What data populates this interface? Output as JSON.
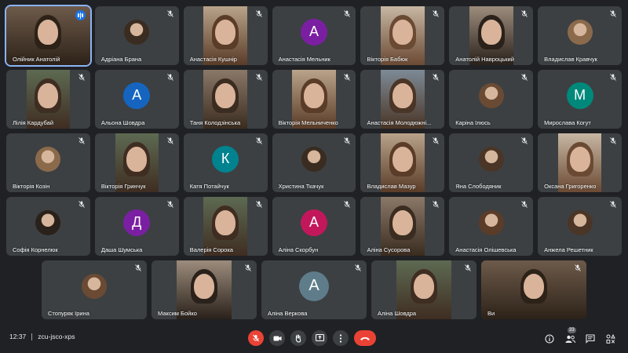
{
  "colors": {
    "accent": "#8ab4f8",
    "danger": "#ea4335",
    "tile": "#3c4043",
    "background": "#202124"
  },
  "participants": [
    {
      "name": "Олійник Анатолій",
      "kind": "video",
      "speaking": true,
      "self": true
    },
    {
      "name": "Адріана Брана",
      "kind": "thumb"
    },
    {
      "name": "Анастасія Кушнір",
      "kind": "video"
    },
    {
      "name": "Анастасія Мельник",
      "kind": "letter",
      "initial": "А",
      "color": "#7b1fa2"
    },
    {
      "name": "Вікторія Бабюк",
      "kind": "video"
    },
    {
      "name": "Анатолій Навроцький",
      "kind": "video"
    },
    {
      "name": "Владислав Кравчук",
      "kind": "thumb"
    },
    {
      "name": "Лілія Кардубай",
      "kind": "video"
    },
    {
      "name": "Альона Шовдра",
      "kind": "letter",
      "initial": "А",
      "color": "#1565c0"
    },
    {
      "name": "Таня Колодзінська",
      "kind": "video"
    },
    {
      "name": "Вікторія Мельниченко",
      "kind": "video"
    },
    {
      "name": "Анастасія Молодюжні...",
      "kind": "video"
    },
    {
      "name": "Каріна Ілюсь",
      "kind": "thumb"
    },
    {
      "name": "Мирослава Когут",
      "kind": "letter",
      "initial": "М",
      "color": "#00897b"
    },
    {
      "name": "Вікторія Козін",
      "kind": "thumb"
    },
    {
      "name": "Вікторія Гринчук",
      "kind": "video"
    },
    {
      "name": "Катя Потайчук",
      "kind": "letter",
      "initial": "К",
      "color": "#00838f"
    },
    {
      "name": "Христина Ткачук",
      "kind": "thumb"
    },
    {
      "name": "Владислав Мазур",
      "kind": "video"
    },
    {
      "name": "Яна Слободяник",
      "kind": "thumb"
    },
    {
      "name": "Оксана Григоренко",
      "kind": "video"
    },
    {
      "name": "Софія Корнелюк",
      "kind": "thumb"
    },
    {
      "name": "Даша Шумська",
      "kind": "letter",
      "initial": "Д",
      "color": "#7b1fa2"
    },
    {
      "name": "Валерія Сорока",
      "kind": "video"
    },
    {
      "name": "Аліна Скорбун",
      "kind": "letter",
      "initial": "А",
      "color": "#c2185b"
    },
    {
      "name": "Аліна Сусорова",
      "kind": "video"
    },
    {
      "name": "Анастасія Олішевська",
      "kind": "thumb"
    },
    {
      "name": "Анжела Решетник",
      "kind": "thumb"
    },
    {
      "name": "Стопуряк Ірина",
      "kind": "thumb"
    },
    {
      "name": "Максим Бойко",
      "kind": "video"
    },
    {
      "name": "Аліна Веркова",
      "kind": "letter",
      "initial": "А",
      "color": "#5f7c8a"
    },
    {
      "name": "Аліна Шовдра",
      "kind": "video"
    },
    {
      "name": "Ви",
      "kind": "video"
    }
  ],
  "rows": [
    7,
    7,
    7,
    7,
    5
  ],
  "bottom": {
    "time": "12:37",
    "meeting_code": "zcu-jsco-xps",
    "participant_count": "33"
  },
  "icons": {
    "mic_off": "mic-off-icon",
    "camera": "camera-icon",
    "hand": "raise-hand-icon",
    "present": "present-screen-icon",
    "more": "more-options-icon",
    "end": "end-call-icon",
    "info": "info-icon",
    "people": "people-icon",
    "chat": "chat-icon",
    "activities": "activities-icon"
  }
}
